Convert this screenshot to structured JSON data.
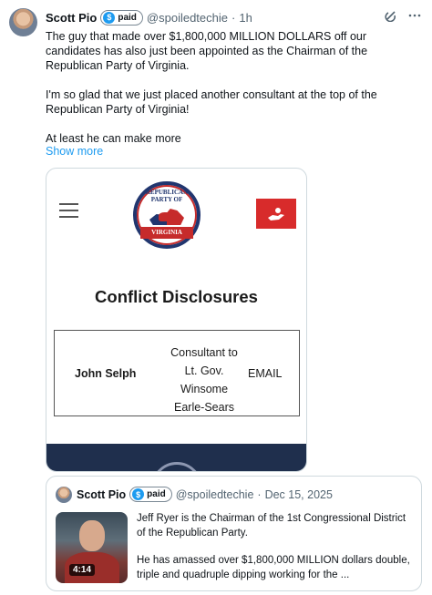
{
  "post": {
    "author": "Scott Pio",
    "badge_label": "paid",
    "badge_icon": "dollar-icon",
    "handle": "@spoiledtechie",
    "dot": "·",
    "time": "1h",
    "paragraphs": [
      "The guy that made over $1,800,000 MILLION DOLLARS off our candidates has also just been appointed as the Chairman of the Republican Party of Virginia.",
      "I'm so glad that we just placed another consultant at the top of the Republican Party of Virginia!",
      "At least he can make more"
    ],
    "show_more": "Show more",
    "icons": [
      "grok-icon",
      "more-icon"
    ]
  },
  "media_card": {
    "logo_top_text": "REPUBLICAN PARTY OF",
    "logo_banner": "VIRGINIA",
    "title": "Conflict Disclosures",
    "table": {
      "name": "John Selph",
      "role_lines": [
        "Consultant to",
        "Lt. Gov.",
        "Winsome",
        "Earle-Sears"
      ],
      "contact": "EMAIL"
    }
  },
  "quote": {
    "author": "Scott Pio",
    "badge_label": "paid",
    "handle": "@spoiledtechie",
    "dot": "·",
    "date": "Dec 15, 2025",
    "video_duration": "4:14",
    "paragraphs": [
      "Jeff Ryer is the Chairman of the 1st Congressional District of the Republican Party.",
      "He has amassed over $1,800,000 MILLION dollars double, triple and quadruple dipping working for the ..."
    ]
  },
  "colors": {
    "link": "#1d9bf0",
    "muted": "#536471",
    "gop_red": "#c62b2b",
    "gop_blue": "#21366f"
  }
}
